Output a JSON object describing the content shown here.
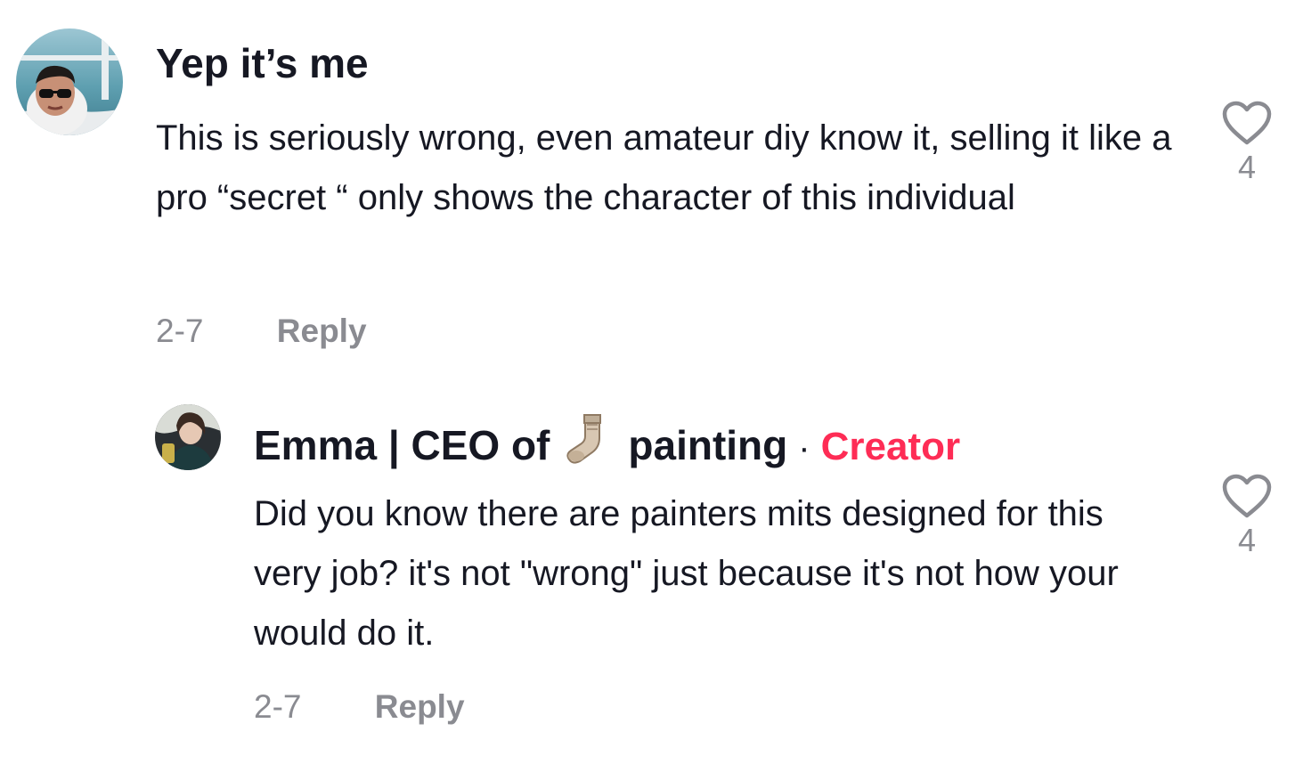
{
  "comments": [
    {
      "username": "Yep it’s me",
      "text": "This is seriously wrong, even amateur diy know it, selling it like a pro “secret “ only shows the character of this individual",
      "date": "2-7",
      "reply_label": "Reply",
      "likes": "4"
    },
    {
      "username_part1": "Emma | CEO of",
      "username_emoji": "socks-emoji",
      "username_part2": "painting",
      "separator": "·",
      "creator_label": "Creator",
      "text": "Did you know there are painters mits designed for this very job? it's not \"wrong\" just because it's not how your would do it.",
      "date": "2-7",
      "reply_label": "Reply",
      "likes": "4"
    }
  ],
  "colors": {
    "creator_accent": "#fe2c55",
    "meta_gray": "#8a8b91",
    "text": "#161823"
  }
}
